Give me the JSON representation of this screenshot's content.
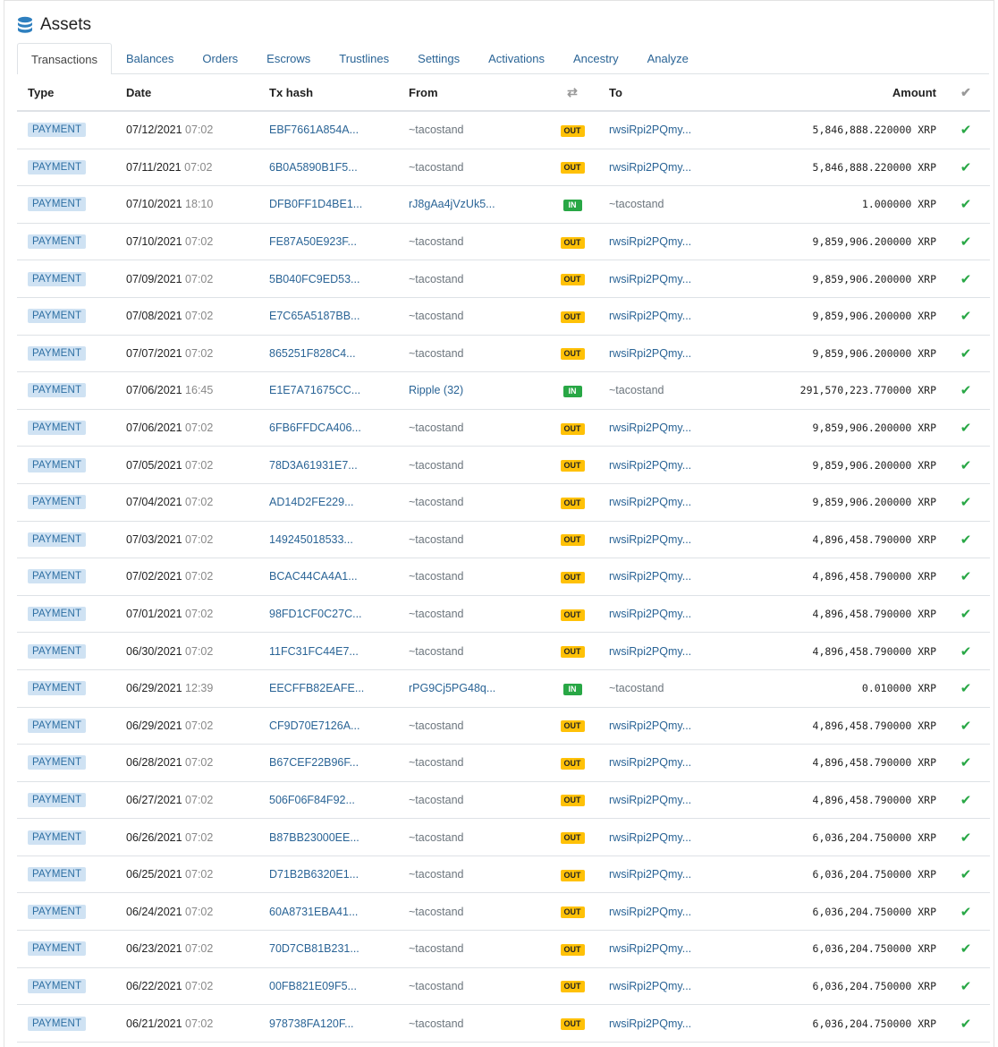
{
  "header": {
    "title": "Assets",
    "icon": "database-icon"
  },
  "tabs": [
    {
      "label": "Transactions",
      "active": true
    },
    {
      "label": "Balances"
    },
    {
      "label": "Orders"
    },
    {
      "label": "Escrows"
    },
    {
      "label": "Trustlines"
    },
    {
      "label": "Settings"
    },
    {
      "label": "Activations"
    },
    {
      "label": "Ancestry"
    },
    {
      "label": "Analyze"
    }
  ],
  "columns": {
    "type": "Type",
    "date": "Date",
    "hash": "Tx hash",
    "from": "From",
    "direction_icon": "swap-icon",
    "to": "To",
    "amount": "Amount",
    "status_icon": "check-icon"
  },
  "rows": [
    {
      "type": "PAYMENT",
      "date": "07/12/2021",
      "time": "07:02",
      "hash": "EBF7661A854A...",
      "from": "~tacostand",
      "dir": "OUT",
      "to": "rwsiRpi2PQmy...",
      "amount": "5,846,888.220000 XRP"
    },
    {
      "type": "PAYMENT",
      "date": "07/11/2021",
      "time": "07:02",
      "hash": "6B0A5890B1F5...",
      "from": "~tacostand",
      "dir": "OUT",
      "to": "rwsiRpi2PQmy...",
      "amount": "5,846,888.220000 XRP"
    },
    {
      "type": "PAYMENT",
      "date": "07/10/2021",
      "time": "18:10",
      "hash": "DFB0FF1D4BE1...",
      "from": "rJ8gAa4jVzUk5...",
      "dir": "IN",
      "to": "~tacostand",
      "amount": "1.000000 XRP"
    },
    {
      "type": "PAYMENT",
      "date": "07/10/2021",
      "time": "07:02",
      "hash": "FE87A50E923F...",
      "from": "~tacostand",
      "dir": "OUT",
      "to": "rwsiRpi2PQmy...",
      "amount": "9,859,906.200000 XRP"
    },
    {
      "type": "PAYMENT",
      "date": "07/09/2021",
      "time": "07:02",
      "hash": "5B040FC9ED53...",
      "from": "~tacostand",
      "dir": "OUT",
      "to": "rwsiRpi2PQmy...",
      "amount": "9,859,906.200000 XRP"
    },
    {
      "type": "PAYMENT",
      "date": "07/08/2021",
      "time": "07:02",
      "hash": "E7C65A5187BB...",
      "from": "~tacostand",
      "dir": "OUT",
      "to": "rwsiRpi2PQmy...",
      "amount": "9,859,906.200000 XRP"
    },
    {
      "type": "PAYMENT",
      "date": "07/07/2021",
      "time": "07:02",
      "hash": "865251F828C4...",
      "from": "~tacostand",
      "dir": "OUT",
      "to": "rwsiRpi2PQmy...",
      "amount": "9,859,906.200000 XRP"
    },
    {
      "type": "PAYMENT",
      "date": "07/06/2021",
      "time": "16:45",
      "hash": "E1E7A71675CC...",
      "from": "Ripple (32)",
      "dir": "IN",
      "to": "~tacostand",
      "amount": "291,570,223.770000 XRP"
    },
    {
      "type": "PAYMENT",
      "date": "07/06/2021",
      "time": "07:02",
      "hash": "6FB6FFDCA406...",
      "from": "~tacostand",
      "dir": "OUT",
      "to": "rwsiRpi2PQmy...",
      "amount": "9,859,906.200000 XRP"
    },
    {
      "type": "PAYMENT",
      "date": "07/05/2021",
      "time": "07:02",
      "hash": "78D3A61931E7...",
      "from": "~tacostand",
      "dir": "OUT",
      "to": "rwsiRpi2PQmy...",
      "amount": "9,859,906.200000 XRP"
    },
    {
      "type": "PAYMENT",
      "date": "07/04/2021",
      "time": "07:02",
      "hash": "AD14D2FE229...",
      "from": "~tacostand",
      "dir": "OUT",
      "to": "rwsiRpi2PQmy...",
      "amount": "9,859,906.200000 XRP"
    },
    {
      "type": "PAYMENT",
      "date": "07/03/2021",
      "time": "07:02",
      "hash": "149245018533...",
      "from": "~tacostand",
      "dir": "OUT",
      "to": "rwsiRpi2PQmy...",
      "amount": "4,896,458.790000 XRP"
    },
    {
      "type": "PAYMENT",
      "date": "07/02/2021",
      "time": "07:02",
      "hash": "BCAC44CA4A1...",
      "from": "~tacostand",
      "dir": "OUT",
      "to": "rwsiRpi2PQmy...",
      "amount": "4,896,458.790000 XRP"
    },
    {
      "type": "PAYMENT",
      "date": "07/01/2021",
      "time": "07:02",
      "hash": "98FD1CF0C27C...",
      "from": "~tacostand",
      "dir": "OUT",
      "to": "rwsiRpi2PQmy...",
      "amount": "4,896,458.790000 XRP"
    },
    {
      "type": "PAYMENT",
      "date": "06/30/2021",
      "time": "07:02",
      "hash": "11FC31FC44E7...",
      "from": "~tacostand",
      "dir": "OUT",
      "to": "rwsiRpi2PQmy...",
      "amount": "4,896,458.790000 XRP"
    },
    {
      "type": "PAYMENT",
      "date": "06/29/2021",
      "time": "12:39",
      "hash": "EECFFB82EAFE...",
      "from": "rPG9Cj5PG48q...",
      "dir": "IN",
      "to": "~tacostand",
      "amount": "0.010000 XRP"
    },
    {
      "type": "PAYMENT",
      "date": "06/29/2021",
      "time": "07:02",
      "hash": "CF9D70E7126A...",
      "from": "~tacostand",
      "dir": "OUT",
      "to": "rwsiRpi2PQmy...",
      "amount": "4,896,458.790000 XRP"
    },
    {
      "type": "PAYMENT",
      "date": "06/28/2021",
      "time": "07:02",
      "hash": "B67CEF22B96F...",
      "from": "~tacostand",
      "dir": "OUT",
      "to": "rwsiRpi2PQmy...",
      "amount": "4,896,458.790000 XRP"
    },
    {
      "type": "PAYMENT",
      "date": "06/27/2021",
      "time": "07:02",
      "hash": "506F06F84F92...",
      "from": "~tacostand",
      "dir": "OUT",
      "to": "rwsiRpi2PQmy...",
      "amount": "4,896,458.790000 XRP"
    },
    {
      "type": "PAYMENT",
      "date": "06/26/2021",
      "time": "07:02",
      "hash": "B87BB23000EE...",
      "from": "~tacostand",
      "dir": "OUT",
      "to": "rwsiRpi2PQmy...",
      "amount": "6,036,204.750000 XRP"
    },
    {
      "type": "PAYMENT",
      "date": "06/25/2021",
      "time": "07:02",
      "hash": "D71B2B6320E1...",
      "from": "~tacostand",
      "dir": "OUT",
      "to": "rwsiRpi2PQmy...",
      "amount": "6,036,204.750000 XRP"
    },
    {
      "type": "PAYMENT",
      "date": "06/24/2021",
      "time": "07:02",
      "hash": "60A8731EBA41...",
      "from": "~tacostand",
      "dir": "OUT",
      "to": "rwsiRpi2PQmy...",
      "amount": "6,036,204.750000 XRP"
    },
    {
      "type": "PAYMENT",
      "date": "06/23/2021",
      "time": "07:02",
      "hash": "70D7CB81B231...",
      "from": "~tacostand",
      "dir": "OUT",
      "to": "rwsiRpi2PQmy...",
      "amount": "6,036,204.750000 XRP"
    },
    {
      "type": "PAYMENT",
      "date": "06/22/2021",
      "time": "07:02",
      "hash": "00FB821E09F5...",
      "from": "~tacostand",
      "dir": "OUT",
      "to": "rwsiRpi2PQmy...",
      "amount": "6,036,204.750000 XRP"
    },
    {
      "type": "PAYMENT",
      "date": "06/21/2021",
      "time": "07:02",
      "hash": "978738FA120F...",
      "from": "~tacostand",
      "dir": "OUT",
      "to": "rwsiRpi2PQmy...",
      "amount": "6,036,204.750000 XRP"
    }
  ]
}
